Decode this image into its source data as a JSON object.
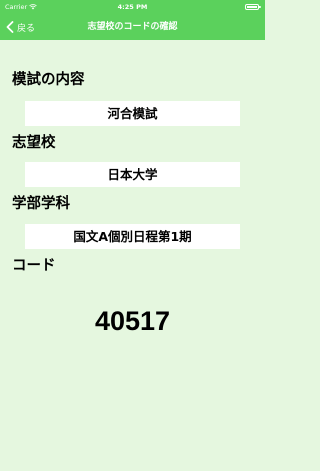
{
  "status_bar": {
    "carrier": "Carrier",
    "time": "4:25 PM"
  },
  "nav": {
    "back_label": "戻る",
    "title": "志望校のコードの確認"
  },
  "sections": [
    {
      "label": "模試の内容",
      "value": "河合模試"
    },
    {
      "label": "志望校",
      "value": "日本大学"
    },
    {
      "label": "学部学科",
      "value": "国文A個別日程第1期"
    }
  ],
  "code": {
    "label": "コード",
    "value": "40517"
  },
  "colors": {
    "accent": "#5bd15c",
    "background": "#e5f7df"
  },
  "icons": {
    "back": "chevron-left-icon",
    "wifi": "wifi-icon",
    "battery": "battery-icon"
  }
}
